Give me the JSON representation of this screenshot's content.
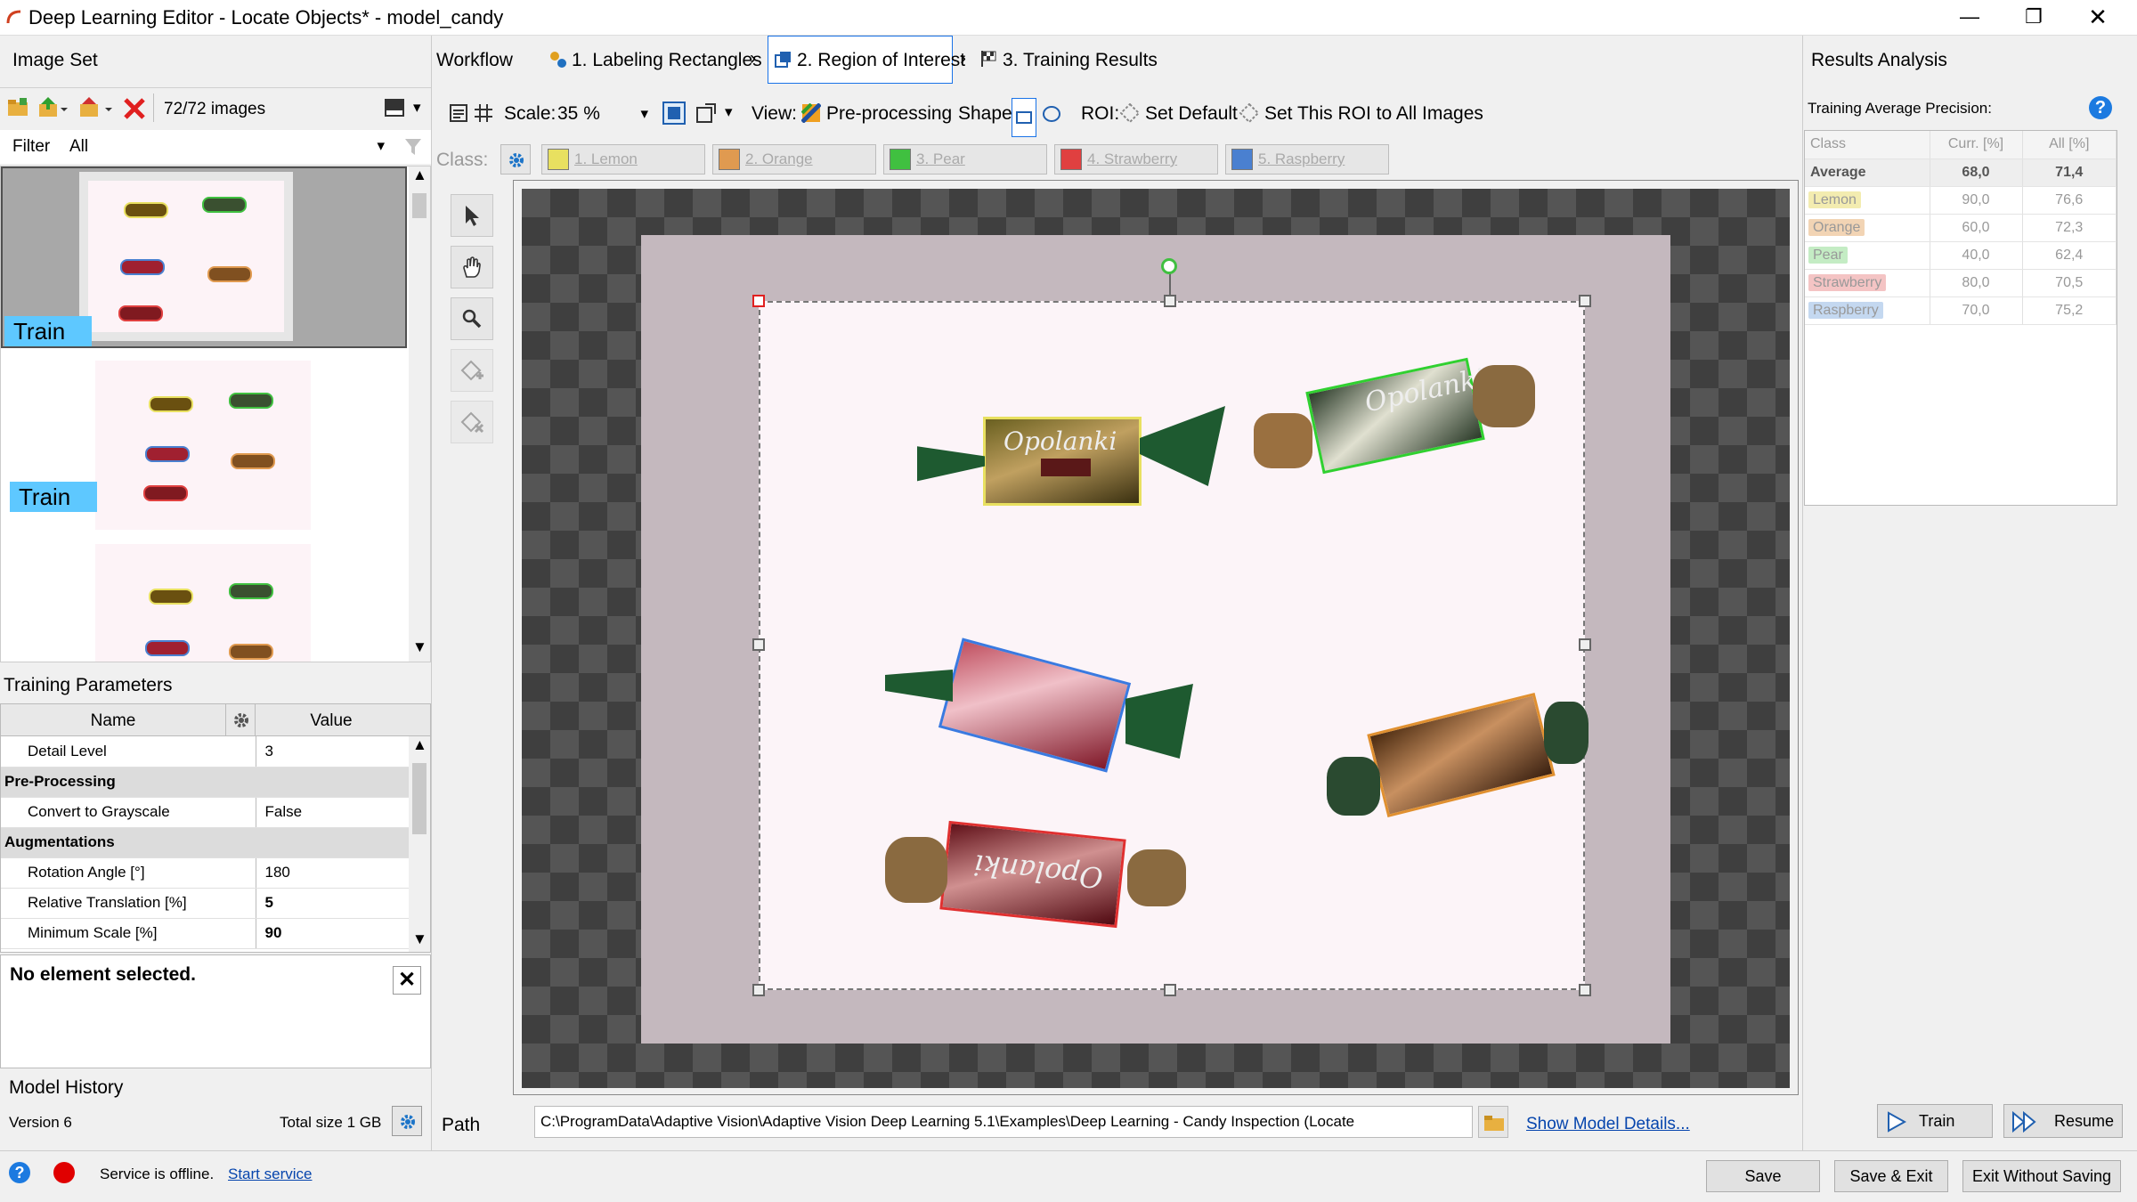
{
  "window": {
    "title": "Deep Learning Editor - Locate Objects* - model_candy"
  },
  "image_set": {
    "title": "Image Set",
    "count": "72/72 images",
    "filter_label": "Filter",
    "filter_value": "All",
    "thumbs": [
      {
        "label": "Train"
      },
      {
        "label": "Train"
      },
      {
        "label": ""
      }
    ]
  },
  "workflow": {
    "label": "Workflow",
    "steps": [
      "1. Labeling Rectangles",
      "2. Region of Interest",
      "3. Training Results"
    ]
  },
  "toolbar": {
    "scale_label": "Scale:",
    "scale_value": "35 %",
    "view_label": "View:",
    "view_value": "Pre-processing",
    "shape_label": "Shape:",
    "roi_label": "ROI:",
    "set_default": "Set Default",
    "set_all": "Set This ROI to All Images"
  },
  "classes": {
    "label": "Class:",
    "items": [
      {
        "name": "1. Lemon",
        "color": "#e8e060"
      },
      {
        "name": "2. Orange",
        "color": "#e09a50"
      },
      {
        "name": "3. Pear",
        "color": "#40c040"
      },
      {
        "name": "4. Strawberry",
        "color": "#e04040"
      },
      {
        "name": "5. Raspberry",
        "color": "#4a80d0"
      }
    ]
  },
  "canvas_labels": {
    "candy1": "Opolanki",
    "candy2": "Opolanki",
    "candy3": "Opolanki"
  },
  "training_params": {
    "title": "Training Parameters",
    "col_name": "Name",
    "col_value": "Value",
    "rows": [
      {
        "name": "Detail Level",
        "value": "3"
      },
      {
        "section": "Pre-Processing"
      },
      {
        "name": "Convert to Grayscale",
        "value": "False"
      },
      {
        "section": "Augmentations"
      },
      {
        "name": "Rotation Angle [°]",
        "value": "180"
      },
      {
        "name": "Relative Translation [%]",
        "value": "5"
      },
      {
        "name": "Minimum Scale [%]",
        "value": "90"
      }
    ]
  },
  "selection": {
    "text": "No element selected."
  },
  "model_history": {
    "title": "Model History",
    "version": "Version 6",
    "total_size": "Total size 1 GB"
  },
  "path": {
    "label": "Path",
    "value": "C:\\ProgramData\\Adaptive Vision\\Adaptive Vision Deep Learning 5.1\\Examples\\Deep Learning - Candy Inspection (Locate",
    "details_link": "Show Model Details..."
  },
  "results": {
    "title": "Results Analysis",
    "subtitle": "Training Average Precision:",
    "headers": [
      "Class",
      "Curr. [%]",
      "All [%]"
    ],
    "rows": [
      {
        "class": "Average",
        "curr": "68,0",
        "all": "71,4",
        "color": ""
      },
      {
        "class": "Lemon",
        "curr": "90,0",
        "all": "76,6",
        "color": "#f3ecb0"
      },
      {
        "class": "Orange",
        "curr": "60,0",
        "all": "72,3",
        "color": "#f2d4b4"
      },
      {
        "class": "Pear",
        "curr": "40,0",
        "all": "62,4",
        "color": "#c4ecc4"
      },
      {
        "class": "Strawberry",
        "curr": "80,0",
        "all": "70,5",
        "color": "#f4c4c4"
      },
      {
        "class": "Raspberry",
        "curr": "70,0",
        "all": "75,2",
        "color": "#c4d8f0"
      }
    ]
  },
  "buttons": {
    "train": "Train",
    "resume": "Resume",
    "save": "Save",
    "save_exit": "Save & Exit",
    "exit_nosave": "Exit Without Saving"
  },
  "status": {
    "text": "Service is offline.",
    "link": "Start service"
  }
}
